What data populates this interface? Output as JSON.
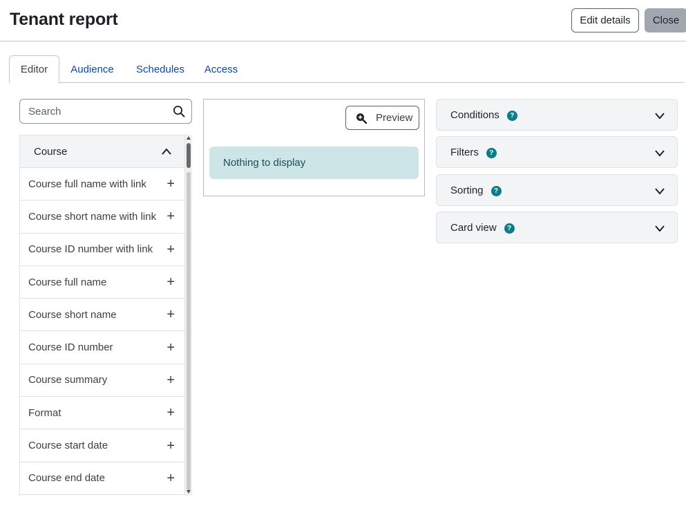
{
  "header": {
    "title": "Tenant report",
    "edit_label": "Edit details",
    "close_label": "Close"
  },
  "tabs": [
    {
      "label": "Editor",
      "active": true
    },
    {
      "label": "Audience",
      "active": false
    },
    {
      "label": "Schedules",
      "active": false
    },
    {
      "label": "Access",
      "active": false
    }
  ],
  "search": {
    "placeholder": "Search",
    "value": "",
    "icon": "search-icon"
  },
  "sidebar": {
    "section_title": "Course",
    "expanded": true,
    "items": [
      {
        "label": "Course full name with link"
      },
      {
        "label": "Course short name with link"
      },
      {
        "label": "Course ID number with link"
      },
      {
        "label": "Course full name"
      },
      {
        "label": "Course short name"
      },
      {
        "label": "Course ID number"
      },
      {
        "label": "Course summary"
      },
      {
        "label": "Format"
      },
      {
        "label": "Course start date"
      },
      {
        "label": "Course end date"
      }
    ]
  },
  "preview": {
    "button_label": "Preview",
    "empty_message": "Nothing to display"
  },
  "settings": {
    "sections": [
      {
        "label": "Conditions"
      },
      {
        "label": "Filters"
      },
      {
        "label": "Sorting"
      },
      {
        "label": "Card view"
      }
    ]
  },
  "colors": {
    "link": "#0f47ad",
    "help_badge": "#0c7c87",
    "alert_bg": "#cee5e8",
    "close_button": "#a2a6b0"
  }
}
